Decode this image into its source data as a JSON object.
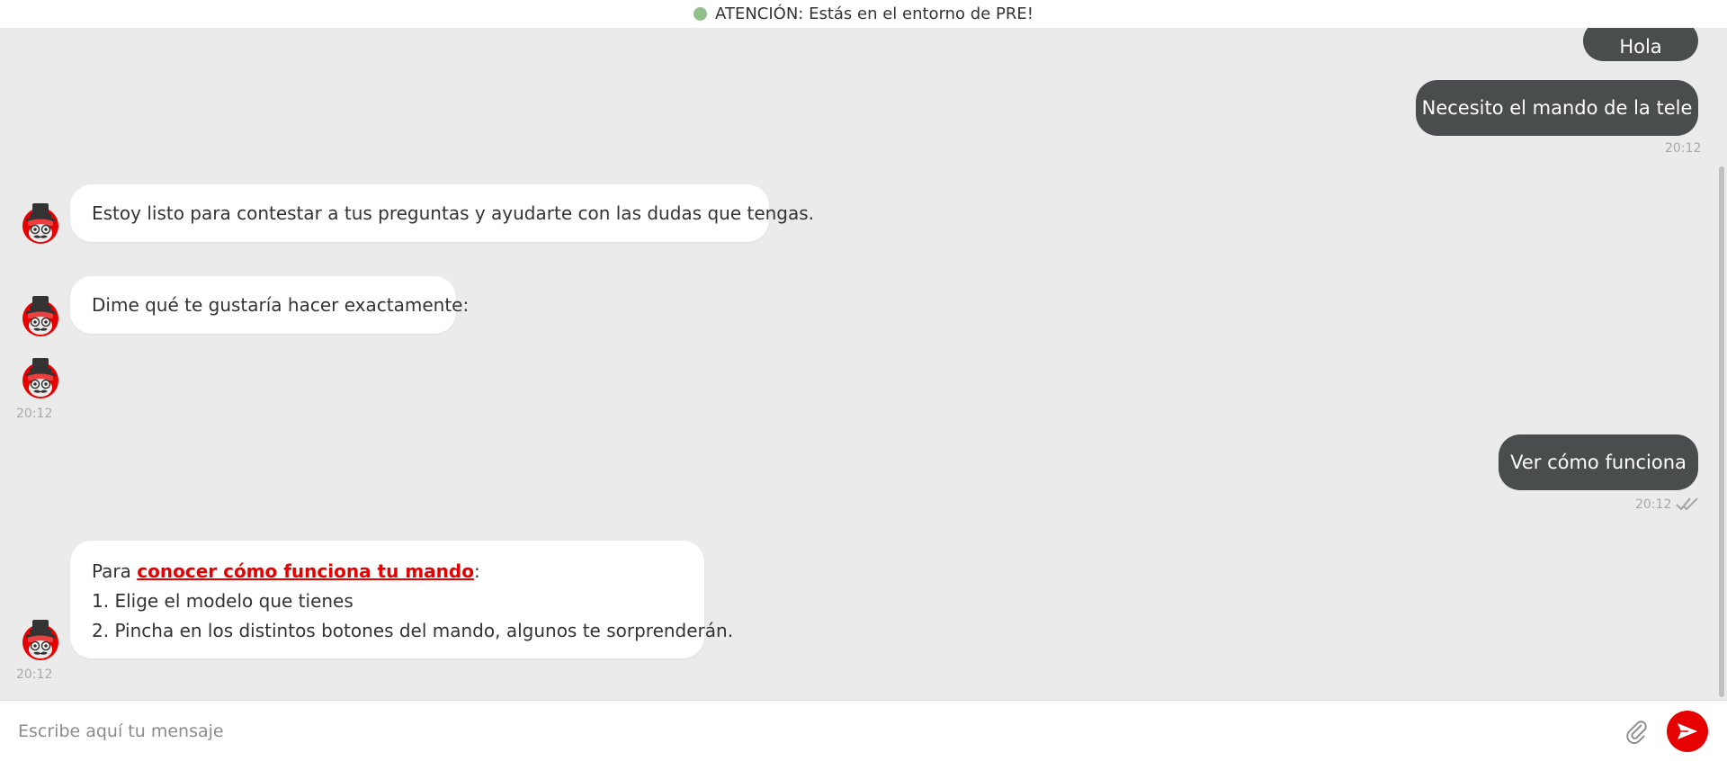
{
  "banner": {
    "text": "ATENCIÓN: Estás en el entorno de PRE!",
    "status_color": "#8fbf8a"
  },
  "messages": {
    "user_1": {
      "text": "Hola"
    },
    "user_2": {
      "text": "Necesito el mando de la tele",
      "time": "20:12"
    },
    "bot_1": {
      "text": "Estoy listo para contestar a tus preguntas y ayudarte con las dudas que tengas."
    },
    "bot_2": {
      "text": "Dime qué te gustaría hacer exactamente:",
      "time": "20:12"
    },
    "user_3": {
      "text": "Ver cómo funciona",
      "time": "20:12"
    },
    "bot_3": {
      "prefix": "Para ",
      "link": "conocer cómo funciona tu mando",
      "suffix": ":",
      "line_1": "1. Elige el modelo que tienes",
      "line_2": "2. Pincha en los distintos botones del mando, algunos te sorprenderán.",
      "time": "20:12"
    }
  },
  "composer": {
    "placeholder": "Escribe aquí tu mensaje"
  },
  "icons": {
    "attach": "paperclip-icon",
    "send": "send-icon",
    "read": "double-check-icon",
    "avatar": "bot-avatar-icon"
  },
  "colors": {
    "accent": "#e60000",
    "user_bubble": "#4a4d4e",
    "bot_bubble": "#ffffff",
    "background": "#ebebeb"
  }
}
